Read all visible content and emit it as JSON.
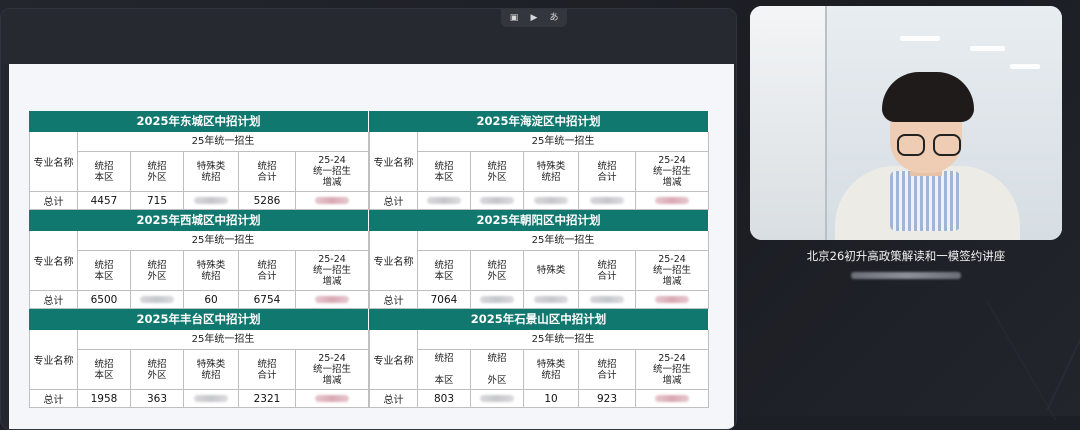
{
  "toolbar": {
    "icons": [
      "sidebar-toggle-icon",
      "screen-share-icon",
      "translate-icon"
    ]
  },
  "document": {
    "header_col": "专业名称",
    "group_label": "25年统一招生",
    "total_label": "总计",
    "blocks": [
      {
        "title": "2025年东城区中招计划",
        "cols": [
          "统招\n本区",
          "统招\n外区",
          "特殊类\n统招",
          "统招\n合计",
          "25-24\n统一招生\n增减"
        ],
        "values": [
          "4457",
          "715",
          "",
          "5286",
          ""
        ]
      },
      {
        "title": "2025年海淀区中招计划",
        "cols": [
          "统招\n本区",
          "统招\n外区",
          "特殊类\n统招",
          "统招\n合计",
          "25-24\n统一招生\n增减"
        ],
        "values": [
          "",
          "",
          "",
          "",
          ""
        ]
      },
      {
        "title": "2025年西城区中招计划",
        "cols": [
          "统招\n本区",
          "统招\n外区",
          "特殊类\n统招",
          "统招\n合计",
          "25-24\n统一招生\n增减"
        ],
        "values": [
          "6500",
          "",
          "60",
          "6754",
          ""
        ]
      },
      {
        "title": "2025年朝阳区中招计划",
        "cols": [
          "统招\n本区",
          "统招\n外区",
          "特殊类",
          "统招\n合计",
          "25-24\n统一招生\n增减"
        ],
        "values": [
          "7064",
          "",
          "",
          "",
          ""
        ]
      },
      {
        "title": "2025年丰台区中招计划",
        "cols": [
          "统招\n本区",
          "统招\n外区",
          "特殊类\n统招",
          "统招\n合计",
          "25-24\n统一招生\n增减"
        ],
        "values": [
          "1958",
          "363",
          "",
          "2321",
          ""
        ]
      },
      {
        "title": "2025年石景山区中招计划",
        "cols": [
          "统招\n\n本区",
          "统招\n\n外区",
          "特殊类\n统招",
          "统招\n合计",
          "25-24\n统一招生\n增减"
        ],
        "values": [
          "803",
          "",
          "10",
          "923",
          ""
        ]
      }
    ]
  },
  "camera": {
    "caption": "北京26初升高政策解读和一模签约讲座"
  }
}
